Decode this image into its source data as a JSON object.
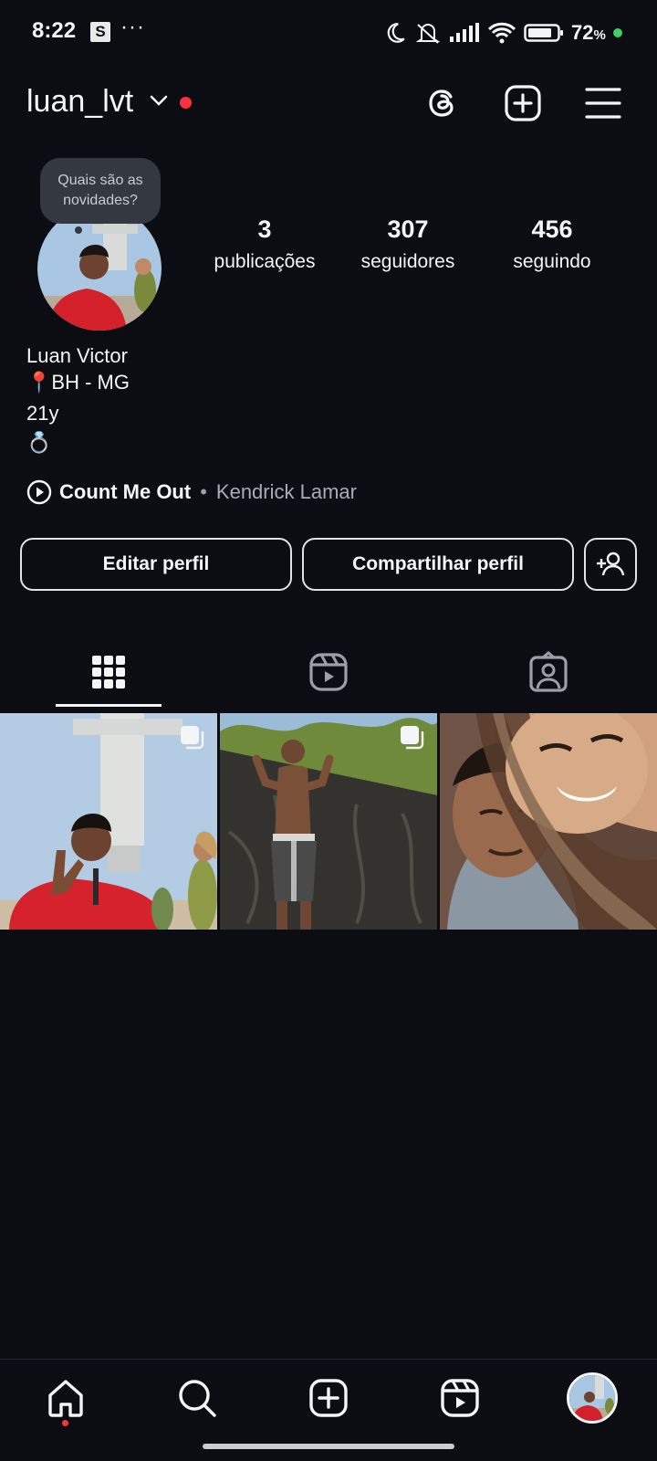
{
  "status_bar": {
    "time": "8:22",
    "app_badge": "S",
    "overflow": "···",
    "battery": "72",
    "battery_suffix": "%"
  },
  "header": {
    "username": "luan_lvt"
  },
  "profile": {
    "note_bubble": "Quais são as novidades?",
    "stats": [
      {
        "value": "3",
        "label": "publicações"
      },
      {
        "value": "307",
        "label": "seguidores"
      },
      {
        "value": "456",
        "label": "seguindo"
      }
    ],
    "name": "Luan Victor",
    "bio_lines": [
      "📍BH - MG",
      "21y",
      "💍"
    ],
    "music": {
      "title": "Count Me Out",
      "separator": "•",
      "artist": "Kendrick Lamar"
    }
  },
  "actions": {
    "edit_profile": "Editar perfil",
    "share_profile": "Compartilhar perfil"
  },
  "tabs": {
    "active": "posts-grid",
    "items": [
      "posts-grid-icon",
      "reels-icon",
      "tagged-icon"
    ]
  },
  "posts": [
    {
      "multiple": true
    },
    {
      "multiple": true
    },
    {
      "multiple": false
    }
  ],
  "bottom_nav": {
    "items": [
      "home-icon",
      "search-icon",
      "create-icon",
      "reels-icon",
      "profile-avatar"
    ]
  },
  "colors": {
    "background": "#0b0d12",
    "notification": "#ff3040",
    "charging": "#3fcf63"
  }
}
